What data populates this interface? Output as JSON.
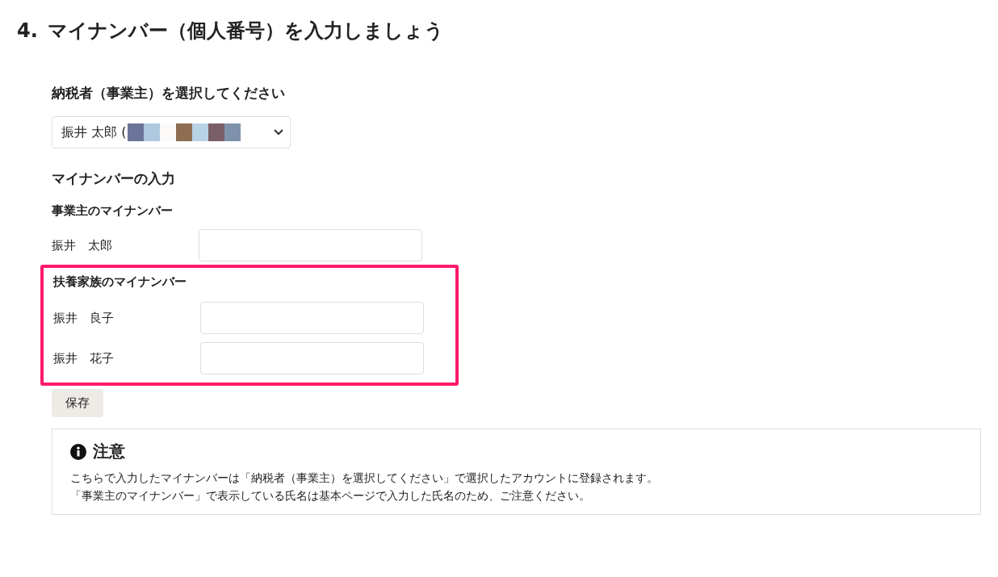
{
  "heading": {
    "number": "4.",
    "title": "マイナンバー（個人番号）を入力しましょう"
  },
  "taxpayer": {
    "label": "納税者（事業主）を選択してください",
    "value": "振井 太郎 ("
  },
  "input_section": {
    "title": "マイナンバーの入力",
    "owner": {
      "title": "事業主のマイナンバー",
      "people": [
        {
          "name": "振井　太郎"
        }
      ]
    },
    "family": {
      "title": "扶養家族のマイナンバー",
      "highlighted": true,
      "people": [
        {
          "name": "振井　良子"
        },
        {
          "name": "振井　花子"
        }
      ]
    }
  },
  "save_button": "保存",
  "notice": {
    "title": "注意",
    "lines": [
      "こちらで入力したマイナンバーは「納税者（事業主）を選択してください」で選択したアカウントに登録されます。",
      "「事業主のマイナンバー」で表示している氏名は基本ページで入力した氏名のため、ご注意ください。"
    ]
  }
}
